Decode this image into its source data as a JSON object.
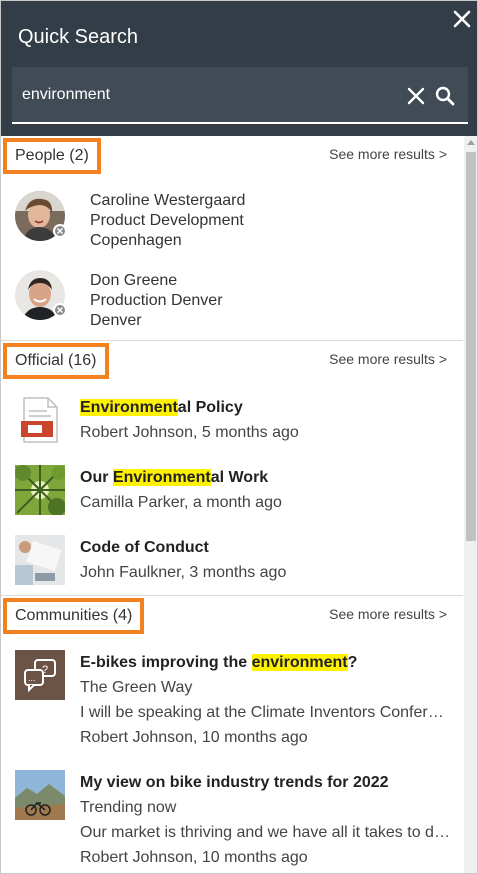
{
  "header": {
    "title": "Quick Search",
    "search_value": "environment"
  },
  "sections": {
    "people": {
      "label": "People (2)",
      "see_more": "See more results >",
      "items": [
        {
          "name": "Caroline Westergaard",
          "department": "Product Development",
          "location": "Copenhagen"
        },
        {
          "name": "Don Greene",
          "department": "Production Denver",
          "location": "Denver"
        }
      ]
    },
    "official": {
      "label": "Official (16)",
      "see_more": "See more results >",
      "items": [
        {
          "title_pre": "",
          "title_hl": "Environment",
          "title_post": "al Policy",
          "meta": "Robert Johnson, 5 months ago"
        },
        {
          "title_pre": "Our ",
          "title_hl": "Environment",
          "title_post": "al Work",
          "meta": "Camilla Parker, a month ago"
        },
        {
          "title_pre": "Code of Conduct",
          "title_hl": "",
          "title_post": "",
          "meta": "John Faulkner, 3 months ago"
        }
      ]
    },
    "communities": {
      "label": "Communities (4)",
      "see_more": "See more results >",
      "items": [
        {
          "title_pre": "E-bikes improving the ",
          "title_hl": "environment",
          "title_post": "?",
          "community": "The Green Way",
          "excerpt": "I will be speaking at the Climate Inventors Conference",
          "meta": "Robert Johnson, 10 months ago"
        },
        {
          "title_pre": "My view on bike industry trends for 2022",
          "title_hl": "",
          "title_post": "",
          "community": "Trending now",
          "excerpt": "Our market is thriving and we have all it takes to do more",
          "meta": "Robert Johnson, 10 months ago"
        }
      ]
    }
  },
  "colors": {
    "header_bg": "#323d47",
    "section_outline": "#f48120",
    "highlight": "#fff200"
  },
  "icons": {
    "close": "close-icon",
    "clear": "clear-icon",
    "search": "search-icon",
    "document": "document-icon",
    "chat": "chat-bubbles-icon",
    "presence": "presence-offline-icon"
  }
}
